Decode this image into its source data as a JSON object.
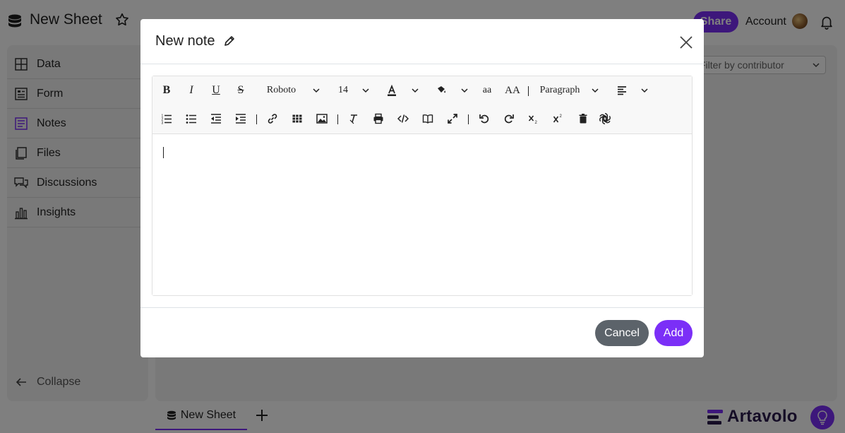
{
  "app": {
    "sheet_title": "New Sheet",
    "share_label": "Share",
    "account_label": "Account",
    "accent_color": "#7b2ff7"
  },
  "sidebar": {
    "items": [
      {
        "label": "Data",
        "icon": "table-icon"
      },
      {
        "label": "Form",
        "icon": "form-icon"
      },
      {
        "label": "Notes",
        "icon": "notes-icon"
      },
      {
        "label": "Files",
        "icon": "files-icon"
      },
      {
        "label": "Discussions",
        "icon": "discussions-icon"
      },
      {
        "label": "Insights",
        "icon": "insights-icon"
      }
    ],
    "collapse_label": "Collapse"
  },
  "main": {
    "contributor_filter_placeholder": "Filter by contributor"
  },
  "bottom": {
    "tab_label": "New Sheet",
    "brand_name": "Artavolo"
  },
  "modal": {
    "title": "New note",
    "toolbar": {
      "font_family": "Roboto",
      "font_size": "14",
      "lowercase_label": "aa",
      "uppercase_label": "AA",
      "block_format": "Paragraph"
    },
    "cancel_label": "Cancel",
    "add_label": "Add"
  }
}
